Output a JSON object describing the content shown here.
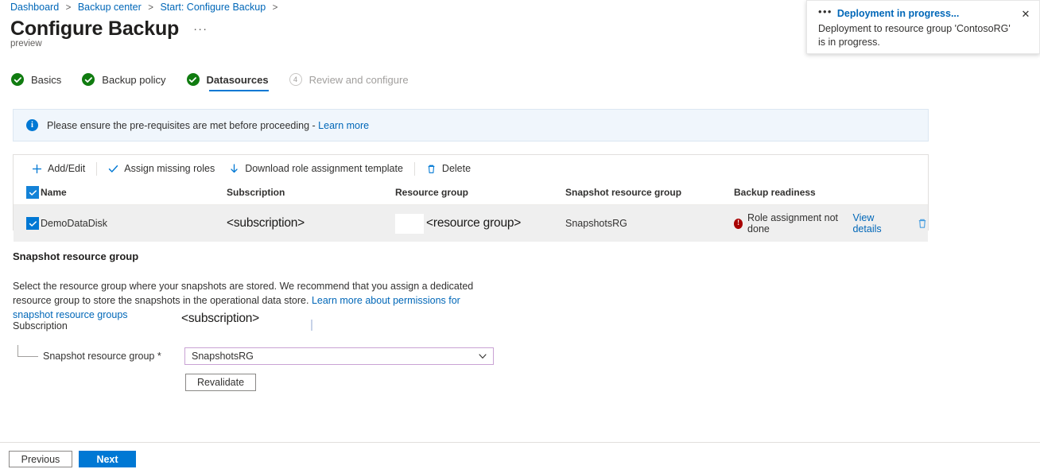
{
  "breadcrumb": {
    "items": [
      "Dashboard",
      "Backup center",
      "Start: Configure Backup"
    ],
    "separator": ">"
  },
  "header": {
    "title": "Configure Backup",
    "more_label": "···",
    "preview_tag": "preview"
  },
  "wizard": {
    "steps": [
      {
        "label": "Basics",
        "state": "complete",
        "icon": "check-icon"
      },
      {
        "label": "Backup policy",
        "state": "complete",
        "icon": "check-icon"
      },
      {
        "label": "Datasources",
        "state": "active-complete",
        "icon": "check-icon"
      },
      {
        "label": "Review and configure",
        "state": "disabled",
        "number": "4"
      }
    ]
  },
  "info_banner": {
    "icon": "info-icon",
    "text": "Please ensure the pre-requisites are met before proceeding - ",
    "link": "Learn more"
  },
  "toolbar": {
    "add_edit": "Add/Edit",
    "assign_roles": "Assign missing roles",
    "download_template": "Download role assignment template",
    "delete": "Delete"
  },
  "table": {
    "columns": [
      "Name",
      "Subscription",
      "Resource group",
      "Snapshot resource group",
      "Backup readiness"
    ],
    "rows": [
      {
        "selected": true,
        "name": "DemoDataDisk",
        "subscription": "<subscription>",
        "resource_group": "<resource group>",
        "snapshot_resource_group": "SnapshotsRG",
        "readiness_status": "Role assignment not done",
        "readiness_link": "View details",
        "delete_icon": "trash-icon"
      }
    ]
  },
  "snapshot_section": {
    "title": "Snapshot resource group",
    "description": "Select the resource group where your snapshots are stored. We recommend that you assign a dedicated resource group to store the snapshots in the operational data store. ",
    "description_link": "Learn more about permissions for snapshot resource groups",
    "subscription_label": "Subscription",
    "subscription_value": "<subscription>",
    "srg_label": "Snapshot resource group *",
    "srg_value": "SnapshotsRG",
    "revalidate_label": "Revalidate"
  },
  "footer": {
    "previous": "Previous",
    "next": "Next"
  },
  "toast": {
    "dots": "•••",
    "title": "Deployment in progress...",
    "body": "Deployment to resource group 'ContosoRG' is in progress.",
    "close_icon": "close-icon"
  },
  "colors": {
    "accent": "#0078d4",
    "link": "#0067b8",
    "success": "#107c10",
    "error": "#a80000",
    "dropdown_border": "#c9a2d4",
    "row_bg": "#efefef"
  }
}
